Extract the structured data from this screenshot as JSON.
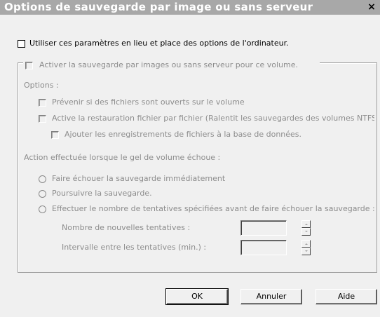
{
  "window": {
    "title": "Options de sauvegarde par image ou sans serveur",
    "close_glyph": "×"
  },
  "use_settings": {
    "label": "Utiliser ces paramètres en lieu et place des options de l'ordinateur.",
    "checked": false
  },
  "group": {
    "enable_label": "Activer la sauvegarde par images ou sans serveur pour ce volume.",
    "options_heading": "Options :",
    "options": [
      {
        "label": "Prévenir si des fichiers sont ouverts sur le volume",
        "checked": false
      },
      {
        "label": "Active la restauration fichier par fichier (Ralentit les sauvegardes des volumes NTFS)",
        "checked": false
      },
      {
        "label": "Ajouter les enregistrements de fichiers à la base de données.",
        "checked": false
      }
    ],
    "action_heading": "Action effectuée lorsque le gel de volume échoue :",
    "radios": [
      {
        "label": "Faire échouer la sauvegarde immédiatement"
      },
      {
        "label": "Poursuivre la sauvegarde."
      },
      {
        "label": "Effectuer le nombre de tentatives spécifiées avant de faire échouer la sauvegarde :"
      }
    ],
    "retry_count_label": "Nombre de nouvelles tentatives :",
    "retry_count_value": "",
    "retry_interval_label": "Intervalle entre les tentatives (min.) :",
    "retry_interval_value": ""
  },
  "buttons": {
    "ok": "OK",
    "cancel": "Annuler",
    "help": "Aide"
  }
}
